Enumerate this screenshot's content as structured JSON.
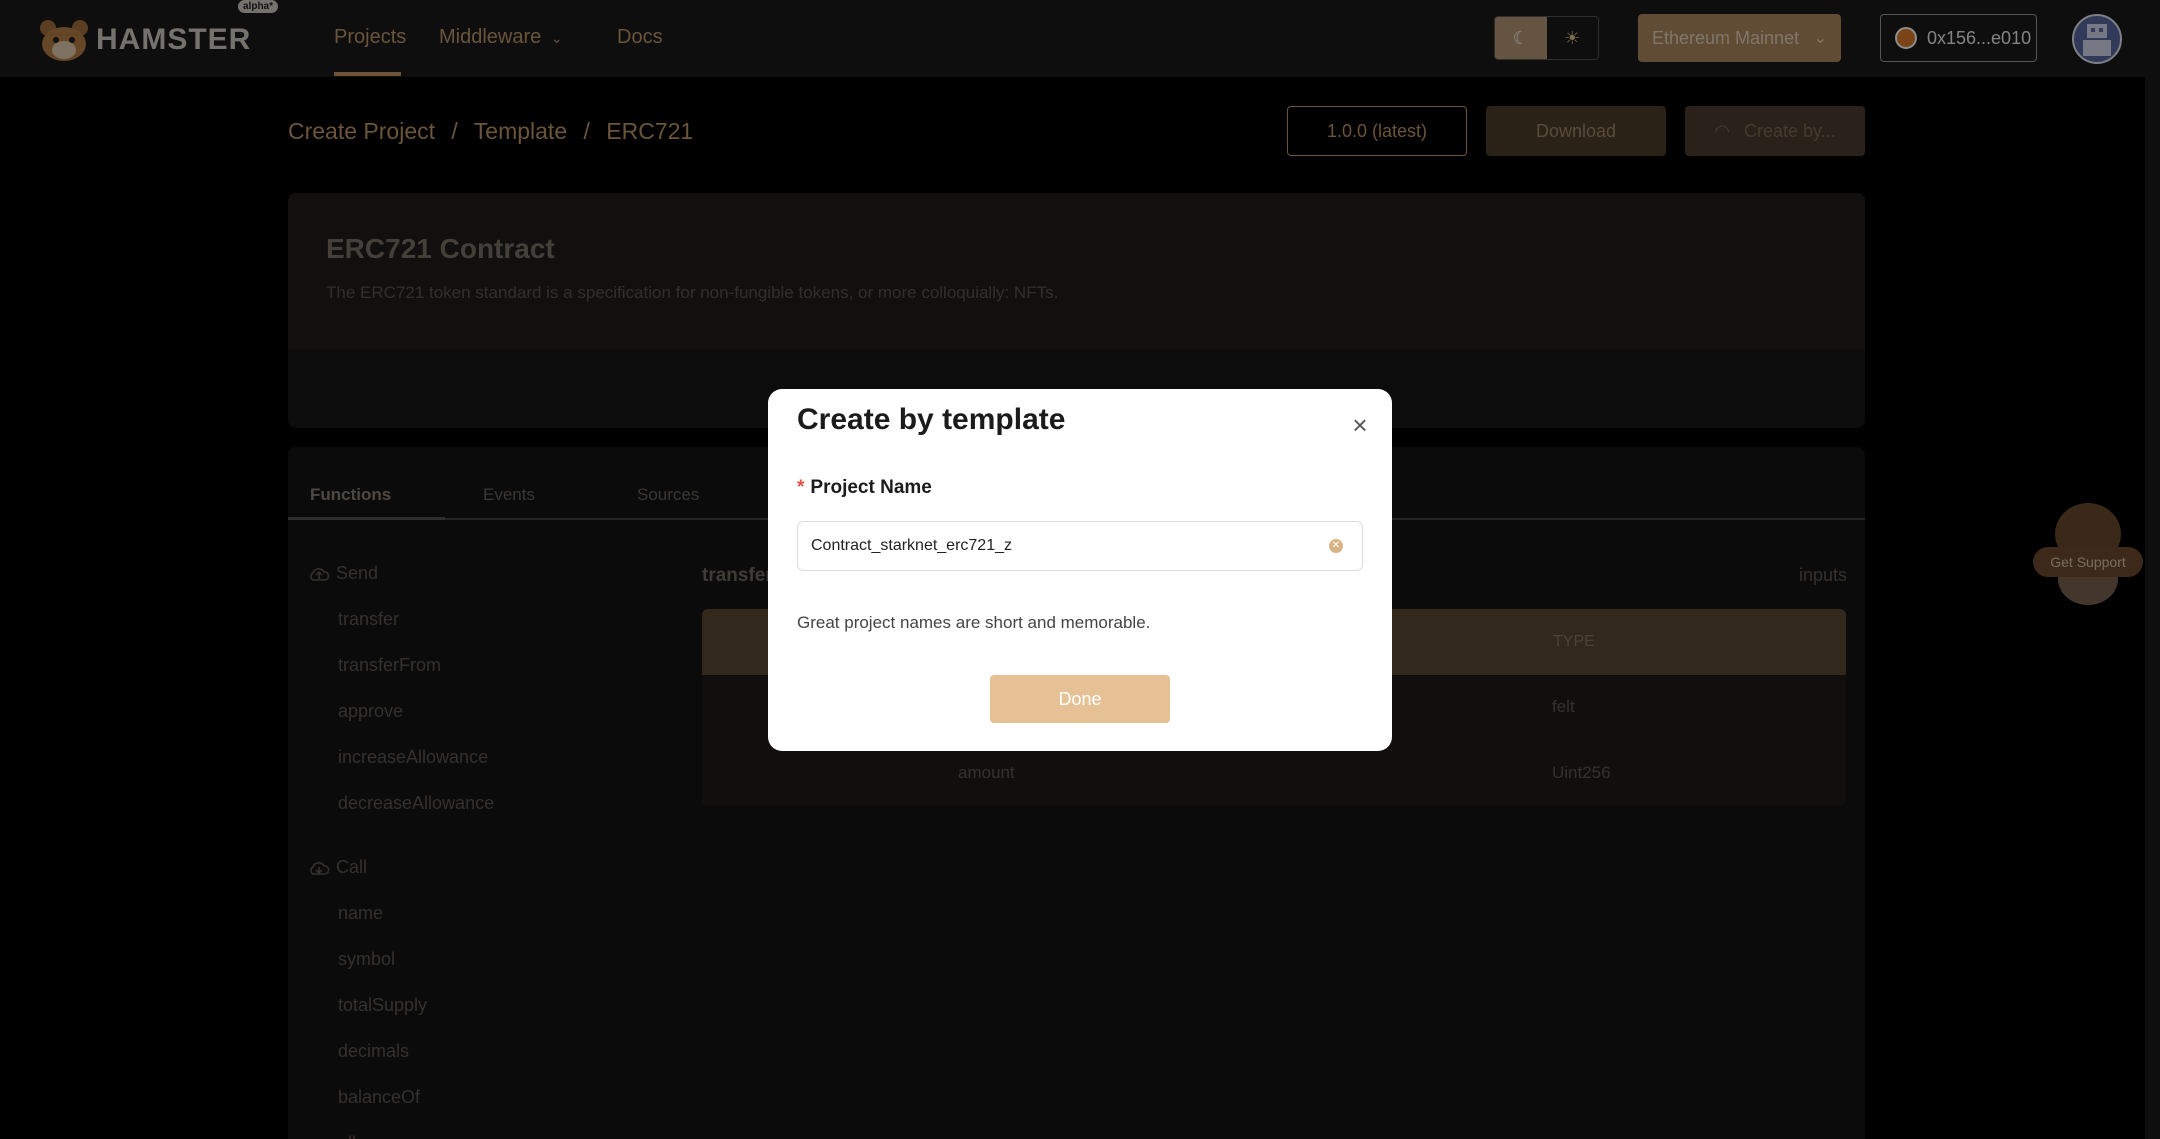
{
  "nav": {
    "logo_text": "HAMSTER",
    "logo_badge": "alpha*",
    "projects": "Projects",
    "middleware": "Middleware",
    "docs": "Docs",
    "network": "Ethereum Mainnet",
    "wallet": "0x156...e010"
  },
  "breadcrumb": {
    "create_project": "Create Project",
    "sep": "/",
    "template": "Template",
    "current": "ERC721"
  },
  "actions": {
    "version": "1.0.0  (latest)",
    "download": "Download",
    "create": "Create by..."
  },
  "contract": {
    "title": "ERC721 Contract",
    "description": "The ERC721 token standard is a specification for non-fungible tokens, or more colloquially: NFTs."
  },
  "tabs": {
    "functions": "Functions",
    "events": "Events",
    "sources": "Sources"
  },
  "functions": {
    "send_label": "Send",
    "send_items": [
      "transfer",
      "transferFrom",
      "approve",
      "increaseAllowance",
      "decreaseAllowance"
    ],
    "call_label": "Call",
    "call_items": [
      "name",
      "symbol",
      "totalSupply",
      "decimals",
      "balanceOf",
      "allowance"
    ]
  },
  "detail": {
    "title": "transfer",
    "inputs_label": "inputs",
    "type_header": "TYPE",
    "rows": [
      {
        "name": "",
        "type": "felt"
      },
      {
        "name": "amount",
        "type": "Uint256"
      }
    ]
  },
  "support": {
    "label": "Get Support"
  },
  "modal": {
    "title": "Create by template",
    "required_mark": "*",
    "field_label": "Project Name",
    "field_value": "Contract_starknet_erc721_z",
    "hint": "Great project names are short and memorable.",
    "done": "Done",
    "close": "×"
  },
  "colors": {
    "accent": "#c19a6b",
    "button": "#e5c195"
  }
}
